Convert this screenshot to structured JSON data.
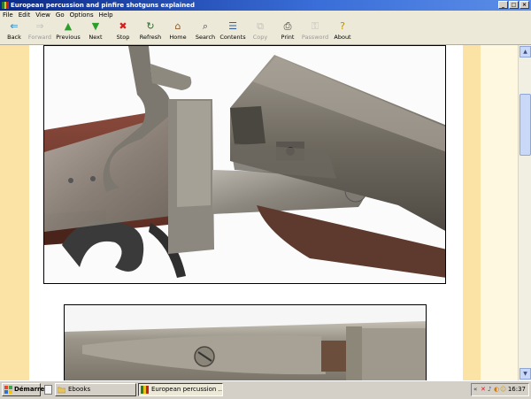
{
  "window": {
    "title": "European percussion and pinfire shotguns explained",
    "controls": {
      "minimize": "_",
      "maximize": "□",
      "close": "×"
    }
  },
  "menu": [
    "File",
    "Edit",
    "View",
    "Go",
    "Options",
    "Help"
  ],
  "toolbar": [
    {
      "label": "Back",
      "icon": "back-arrow-icon",
      "glyph": "⇐",
      "color": "#1a7fc9",
      "enabled": true
    },
    {
      "label": "Forward",
      "icon": "forward-arrow-icon",
      "glyph": "⇒",
      "color": "#888888",
      "enabled": false
    },
    {
      "label": "Previous",
      "icon": "previous-arrow-icon",
      "glyph": "▲",
      "color": "#2aa02a",
      "enabled": true
    },
    {
      "label": "Next",
      "icon": "next-arrow-icon",
      "glyph": "▼",
      "color": "#2aa02a",
      "enabled": true
    },
    {
      "label": "Stop",
      "icon": "stop-icon",
      "glyph": "✖",
      "color": "#d81d1d",
      "enabled": true
    },
    {
      "label": "Refresh",
      "icon": "refresh-icon",
      "glyph": "↻",
      "color": "#2a6a2a",
      "enabled": true
    },
    {
      "label": "Home",
      "icon": "home-icon",
      "glyph": "⌂",
      "color": "#8a5a2a",
      "enabled": true
    },
    {
      "label": "Search",
      "icon": "search-icon",
      "glyph": "⌕",
      "color": "#444444",
      "enabled": true
    },
    {
      "label": "Contents",
      "icon": "contents-icon",
      "glyph": "☰",
      "color": "#3060a0",
      "enabled": true
    },
    {
      "label": "Copy",
      "icon": "copy-icon",
      "glyph": "⧉",
      "color": "#999999",
      "enabled": false
    },
    {
      "label": "Print",
      "icon": "print-icon",
      "glyph": "⎙",
      "color": "#333333",
      "enabled": true
    },
    {
      "label": "Password",
      "icon": "key-icon",
      "glyph": "⚿",
      "color": "#999999",
      "enabled": false
    },
    {
      "label": "About",
      "icon": "about-icon",
      "glyph": "?",
      "color": "#b89000",
      "enabled": true
    }
  ],
  "colors": {
    "margin_column": "#fbe2a5",
    "gutter": "#fff8e0",
    "titlebar_start": "#0a2a8a",
    "titlebar_end": "#5c8ee8"
  },
  "taskbar": {
    "start_label": "Démarrer",
    "tasks": [
      {
        "label": "Ebooks",
        "icon": "folder-icon",
        "active": false
      },
      {
        "label": "European percussion ...",
        "icon": "ebook-icon",
        "active": true
      }
    ],
    "tray_icons": [
      "«",
      "✕",
      "♪",
      "◐",
      "☺"
    ],
    "clock": "16:37"
  }
}
